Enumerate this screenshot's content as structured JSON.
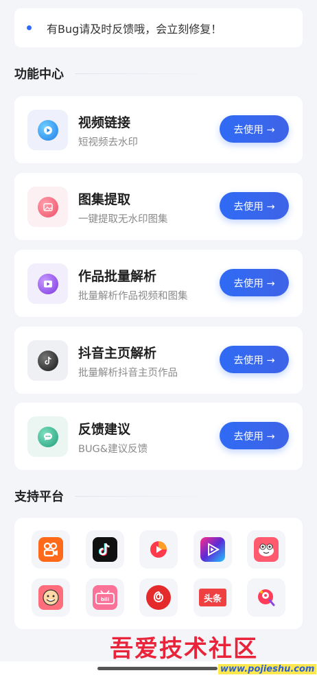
{
  "notice": {
    "text": "有Bug请及时反馈哦，会立刻修复！"
  },
  "features_section": {
    "title": "功能中心"
  },
  "features": [
    {
      "title": "视频链接",
      "subtitle": "短视频去水印",
      "button": "去使用 →",
      "icon": "play-icon",
      "color": "#2a8df0"
    },
    {
      "title": "图集提取",
      "subtitle": "一键提取无水印图集",
      "button": "去使用 →",
      "icon": "image-icon",
      "color": "#f0566b"
    },
    {
      "title": "作品批量解析",
      "subtitle": "批量解析作品视频和图集",
      "button": "去使用 →",
      "icon": "video-batch-icon",
      "color": "#8a45e0"
    },
    {
      "title": "抖音主页解析",
      "subtitle": "批量解析抖音主页作品",
      "button": "去使用 →",
      "icon": "tiktok-icon",
      "color": "#2a2a2a"
    },
    {
      "title": "反馈建议",
      "subtitle": "BUG&建议反馈",
      "button": "去使用 →",
      "icon": "chat-icon",
      "color": "#2bb08a"
    }
  ],
  "platforms_section": {
    "title": "支持平台"
  },
  "platforms": [
    {
      "name": "kuaishou-icon",
      "color": "#ff6a1a"
    },
    {
      "name": "douyin-icon",
      "color": "#111111"
    },
    {
      "name": "weishi-icon",
      "color": "#ff3a4a"
    },
    {
      "name": "purple-video-icon",
      "color": "#5a2bd6"
    },
    {
      "name": "pipixia-icon",
      "color": "#ff5a6e"
    },
    {
      "name": "zuiyou-icon",
      "color": "#ff6e7a"
    },
    {
      "name": "bilibili-icon",
      "color": "#fb7299"
    },
    {
      "name": "netease-music-icon",
      "color": "#e42a2a"
    },
    {
      "name": "toutiao-icon",
      "color": "#f04142",
      "label": "头条"
    },
    {
      "name": "momo-icon",
      "color": "#ff3d5a"
    }
  ],
  "watermark": {
    "text": "吾爱技术社区",
    "url": "www.pojieshu.com"
  }
}
